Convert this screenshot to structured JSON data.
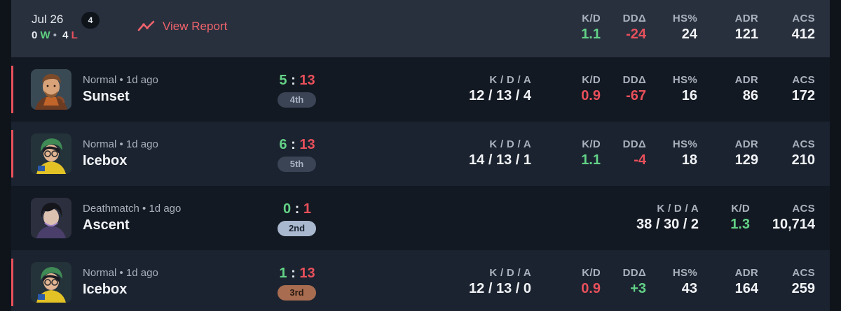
{
  "summary": {
    "date": "Jul 26",
    "match_count": "4",
    "wins": "0",
    "win_suffix": "W",
    "losses": "4",
    "loss_suffix": "L",
    "view_report": "View Report",
    "stats": {
      "kd_label": "K/D",
      "kd": "1.1",
      "dd_label": "DDΔ",
      "dd": "-24",
      "hs_label": "HS%",
      "hs": "24",
      "adr_label": "ADR",
      "adr": "121",
      "acs_label": "ACS",
      "acs": "412"
    }
  },
  "matches": [
    {
      "mode": "Normal • 1d ago",
      "map": "Sunset",
      "score_team": "5",
      "score_enemy": "13",
      "placement": "4th",
      "kda_label": "K / D / A",
      "kda": "12 / 13 / 4",
      "kd_label": "K/D",
      "kd": "0.9",
      "dd_label": "DDΔ",
      "dd": "-67",
      "hs_label": "HS%",
      "hs": "16",
      "adr_label": "ADR",
      "adr": "86",
      "acs_label": "ACS",
      "acs": "172"
    },
    {
      "mode": "Normal • 1d ago",
      "map": "Icebox",
      "score_team": "6",
      "score_enemy": "13",
      "placement": "5th",
      "kda_label": "K / D / A",
      "kda": "14 / 13 / 1",
      "kd_label": "K/D",
      "kd": "1.1",
      "dd_label": "DDΔ",
      "dd": "-4",
      "hs_label": "HS%",
      "hs": "18",
      "adr_label": "ADR",
      "adr": "129",
      "acs_label": "ACS",
      "acs": "210"
    },
    {
      "mode": "Deathmatch • 1d ago",
      "map": "Ascent",
      "score_team": "0",
      "score_enemy": "1",
      "placement": "2nd",
      "kda_label": "K / D / A",
      "kda": "38 / 30 / 2",
      "kd_label": "K/D",
      "kd": "1.3",
      "acs_label": "ACS",
      "acs": "10,714"
    },
    {
      "mode": "Normal • 1d ago",
      "map": "Icebox",
      "score_team": "1",
      "score_enemy": "13",
      "placement": "3rd",
      "kda_label": "K / D / A",
      "kda": "12 / 13 / 0",
      "kd_label": "K/D",
      "kd": "0.9",
      "dd_label": "DDΔ",
      "dd": "+3",
      "hs_label": "HS%",
      "hs": "43",
      "adr_label": "ADR",
      "adr": "164",
      "acs_label": "ACS",
      "acs": "259"
    }
  ],
  "colors": {
    "win": "#63d287",
    "loss": "#e8505b",
    "header_bg": "#28303e",
    "row_dark": "#131922",
    "row_light": "#1b2330"
  },
  "icons": [
    "trend-line-icon",
    "agent-portrait-icon"
  ]
}
